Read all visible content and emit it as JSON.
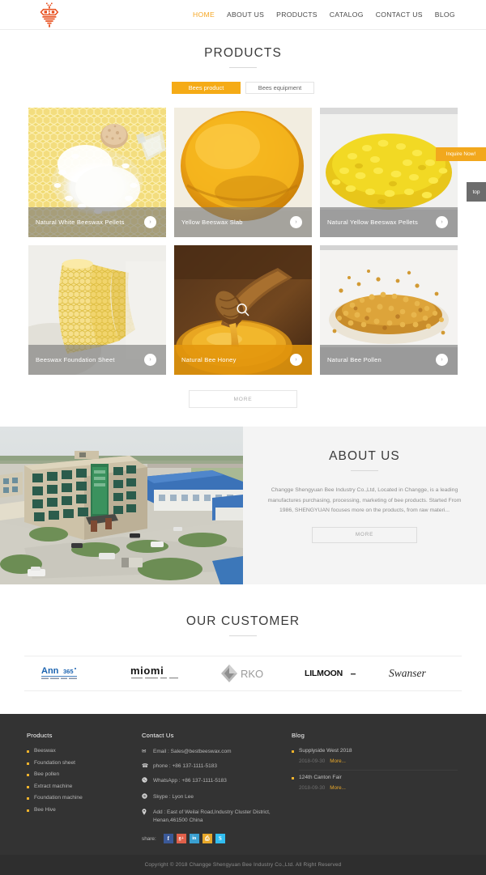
{
  "header": {
    "logo_icon": "bee-logo-icon",
    "logo_color": "#e8501f",
    "nav": [
      {
        "label": "HOME",
        "active": true
      },
      {
        "label": "ABOUT US",
        "active": false
      },
      {
        "label": "PRODUCTS",
        "active": false
      },
      {
        "label": "CATALOG",
        "active": false
      },
      {
        "label": "CONTACT US",
        "active": false
      },
      {
        "label": "BLOG",
        "active": false
      }
    ],
    "accent_color": "#f5a623"
  },
  "products": {
    "title": "PRODUCTS",
    "tabs": [
      {
        "label": "Bees product",
        "active": true
      },
      {
        "label": "Bees equipment",
        "active": false
      }
    ],
    "items": [
      {
        "name": "Natural White Beeswax Pellets",
        "image": "white-beeswax-pellets-photo",
        "hovered": false
      },
      {
        "name": "Yellow Beeswax Slab",
        "image": "yellow-beeswax-slab-photo",
        "hovered": false
      },
      {
        "name": "Natural Yellow Beeswax Pellets",
        "image": "yellow-beeswax-pellets-photo",
        "hovered": false
      },
      {
        "name": "Beeswax Foundation Sheet",
        "image": "beeswax-foundation-sheet-photo",
        "hovered": false
      },
      {
        "name": "Natural Bee Honey",
        "image": "bee-honey-photo",
        "hovered": true
      },
      {
        "name": "Natural Bee Pollen",
        "image": "bee-pollen-photo",
        "hovered": false
      }
    ],
    "more_label": "MORE",
    "tab_active_color": "#f5ab16"
  },
  "about": {
    "title": "ABOUT US",
    "image": "factory-aerial-photo",
    "text": "Changge Shengyuan Bee Industry Co.,Ltd, Located in Changge, is a leading manufactures purchasing, processing, marketing of bee products. Started From 1986, SHENGYUAN focuses more on the products, from raw materi...",
    "more_label": "MORE"
  },
  "customers": {
    "title": "OUR CUSTOMER",
    "logos": [
      {
        "name": "Ann365",
        "mark": "ann365-logo",
        "color": "#1b63b0",
        "tagline": "PREMIUM COLOR CONTACT LENSES"
      },
      {
        "name": "miomi",
        "mark": "miomi-logo",
        "color": "#1a1a1a",
        "tagline": "COLOR CONTACT LENSES"
      },
      {
        "name": "RKO",
        "mark": "rko-logo",
        "color": "#9a9a9a",
        "tagline": ""
      },
      {
        "name": "LILMOON",
        "mark": "lilmoon-logo",
        "color": "#111111",
        "tagline": ""
      },
      {
        "name": "Swanser",
        "mark": "swanser-logo",
        "color": "#2b2b2b",
        "tagline": ""
      }
    ]
  },
  "footer": {
    "products": {
      "heading": "Products",
      "items": [
        "Beeswax",
        "Foundation sheet",
        "Bee pollen",
        "Extract machine",
        "Foundation machine",
        "Bee Hive"
      ]
    },
    "contact": {
      "heading": "Contact Us",
      "lines": [
        {
          "icon": "envelope-icon",
          "glyph": "✉",
          "text": "Email : Sales@bestbeeswax.com"
        },
        {
          "icon": "telephone-icon",
          "glyph": "☎",
          "text": "phone : +86 137-1111-5183"
        },
        {
          "icon": "whatsapp-icon",
          "glyph": "✆",
          "text": "WhatsApp : +86 137-1111-5183"
        },
        {
          "icon": "skype-icon",
          "glyph": "●",
          "text": "Skype : Lyon Lee"
        },
        {
          "icon": "location-pin-icon",
          "glyph": "☉",
          "text": "Add : East of Weilai Road,Industry Cluster District, Henan,461500 China"
        }
      ],
      "share_label": "share:",
      "share_icons": [
        {
          "name": "facebook-icon",
          "glyph": "f",
          "color": "#3b5998"
        },
        {
          "name": "google-plus-icon",
          "glyph": "g+",
          "color": "#e0604a"
        },
        {
          "name": "linkedin-icon",
          "glyph": "in",
          "color": "#3a9fd0"
        },
        {
          "name": "print-icon",
          "glyph": "⎙",
          "color": "#e8a82a"
        },
        {
          "name": "skype-share-icon",
          "glyph": "S",
          "color": "#31bdf0"
        }
      ]
    },
    "blog": {
      "heading": "Blog",
      "items": [
        {
          "title": "Supplyside West 2018",
          "date": "2018-09-30",
          "more": "More..."
        },
        {
          "title": "124th Canton Fair",
          "date": "2018-09-30",
          "more": "More..."
        }
      ]
    },
    "copyright": "Copyright © 2018 Changge Shengyuan Bee Industry Co.,Ltd. All Right Reserved"
  },
  "floating": {
    "inquire_label": "Inquire Now!",
    "inquire_color": "#f2a81d",
    "top_label": "top",
    "top_color": "#6c6c6c"
  }
}
